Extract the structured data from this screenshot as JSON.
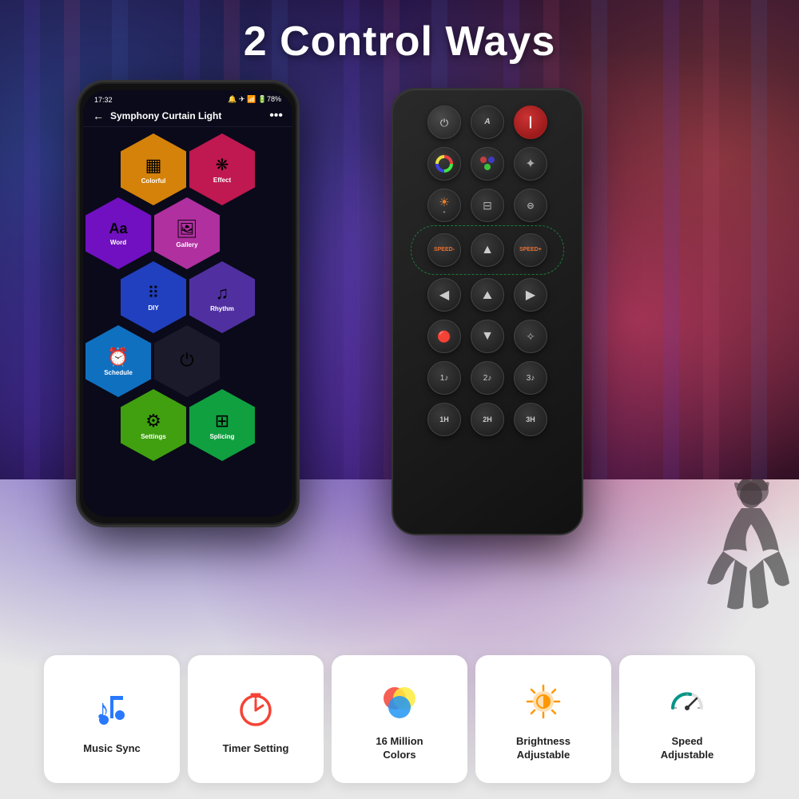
{
  "title": "2 Control Ways",
  "phone": {
    "status_time": "17:32",
    "status_icons": "🔔 ⚡ 📶 📶 78%",
    "nav_title": "Symphony Curtain Light",
    "hex_items": [
      {
        "label": "Colorful",
        "color": "#e8a020",
        "icon": "▦"
      },
      {
        "label": "Effect",
        "color": "#e82060",
        "icon": "❋"
      },
      {
        "label": "Word",
        "color": "#9020e8",
        "icon": "Aa"
      },
      {
        "label": "Gallery",
        "color": "#d040a0",
        "icon": "🖼"
      },
      {
        "label": "DIY",
        "color": "#4060e8",
        "icon": "⠿"
      },
      {
        "label": "Rhythm",
        "color": "#6040c0",
        "icon": "♪"
      },
      {
        "label": "Schedule",
        "color": "#2080e0",
        "icon": "⏰"
      },
      {
        "label": "Power",
        "color": "#222",
        "icon": "⏻"
      },
      {
        "label": "Settings",
        "color": "#60b020",
        "icon": "⚙"
      },
      {
        "label": "Splicing",
        "color": "#20c060",
        "icon": "⊞"
      }
    ]
  },
  "remote": {
    "buttons": {
      "row1": [
        "power",
        "auto",
        "on"
      ],
      "row2": [
        "color_wheel",
        "palette",
        "star"
      ],
      "row3": [
        "brightness_up",
        "curtain",
        "speed_down"
      ],
      "row4_label": "speed controls",
      "row5": [
        "left",
        "up_triangle",
        "right"
      ],
      "row6": [
        "scene1",
        "down",
        "sparkle"
      ],
      "row7": [
        "timer1",
        "timer2",
        "timer3"
      ],
      "row8": [
        "h1",
        "h2",
        "h3"
      ]
    }
  },
  "features": [
    {
      "id": "music-sync",
      "label": "Music Sync",
      "icon_type": "music"
    },
    {
      "id": "timer-setting",
      "label": "Timer Setting",
      "icon_type": "timer"
    },
    {
      "id": "16m-colors",
      "label": "16 Million\nColors",
      "icon_type": "colors"
    },
    {
      "id": "brightness",
      "label": "Brightness\nAdjustable",
      "icon_type": "brightness"
    },
    {
      "id": "speed",
      "label": "Speed\nAdjustable",
      "icon_type": "speed"
    }
  ],
  "colors": {
    "accent_blue": "#2979ff",
    "accent_red": "#f44336",
    "accent_green": "#4caf50",
    "accent_orange": "#ff9800",
    "accent_teal": "#009688"
  }
}
